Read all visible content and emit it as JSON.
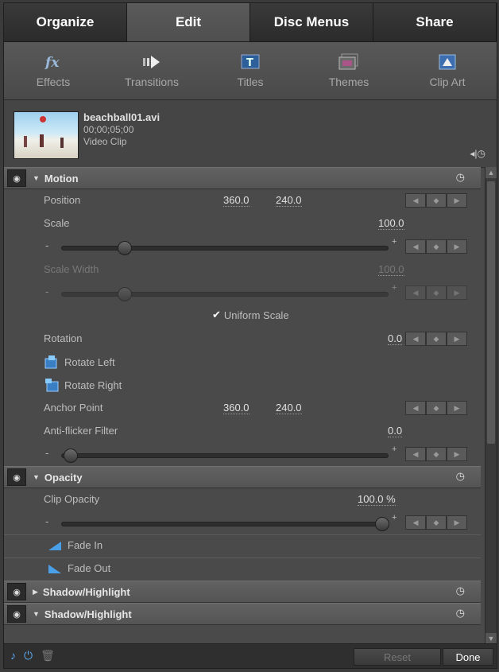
{
  "tabs": [
    "Organize",
    "Edit",
    "Disc Menus",
    "Share"
  ],
  "active_tab": "Edit",
  "toolbar": [
    "Effects",
    "Transitions",
    "Titles",
    "Themes",
    "Clip Art"
  ],
  "clip": {
    "name": "beachball01.avi",
    "timecode": "00;00;05;00",
    "type": "Video Clip"
  },
  "motion": {
    "title": "Motion",
    "position_label": "Position",
    "position_x": "360.0",
    "position_y": "240.0",
    "scale_label": "Scale",
    "scale_value": "100.0",
    "scale_width_label": "Scale Width",
    "scale_width_value": "100.0",
    "uniform_label": "Uniform Scale",
    "rotation_label": "Rotation",
    "rotation_value": "0.0",
    "rotate_left": "Rotate Left",
    "rotate_right": "Rotate Right",
    "anchor_label": "Anchor Point",
    "anchor_x": "360.0",
    "anchor_y": "240.0",
    "flicker_label": "Anti-flicker Filter",
    "flicker_value": "0.0"
  },
  "opacity": {
    "title": "Opacity",
    "clip_opacity_label": "Clip Opacity",
    "clip_opacity_value": "100.0 %",
    "fade_in": "Fade In",
    "fade_out": "Fade Out"
  },
  "shadow1": "Shadow/Highlight",
  "shadow2": "Shadow/Highlight",
  "bottom": {
    "reset": "Reset",
    "done": "Done"
  },
  "slider_minus": "-",
  "slider_plus": "+",
  "kf_prev": "◀",
  "kf_add": "◆",
  "kf_next": "▶"
}
